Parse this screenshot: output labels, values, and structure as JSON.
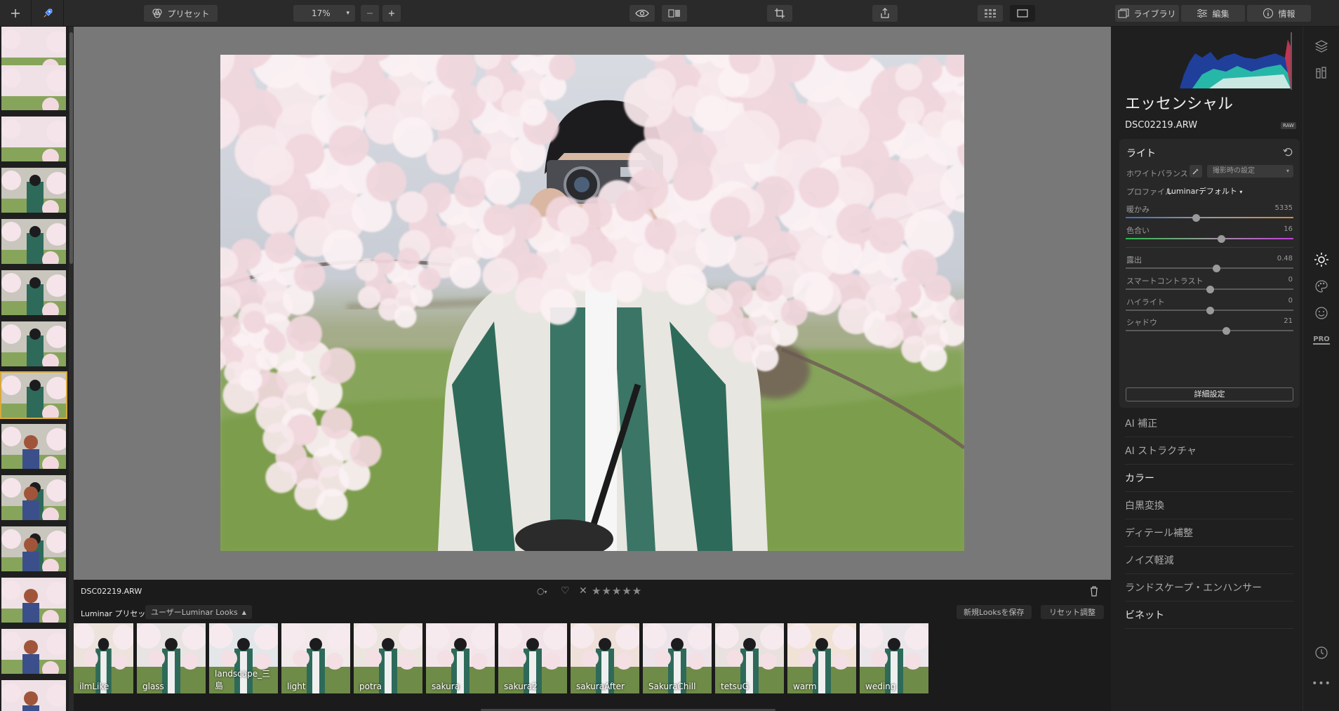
{
  "toolbar": {
    "preset_label": "プリセット",
    "zoom_value": "17%",
    "library_tab": "ライブラリ",
    "edit_tab": "編集",
    "info_tab": "情報"
  },
  "info_bar": {
    "filename": "DSC02219.ARW",
    "star_count": 5,
    "rating_stars": "★★★★★"
  },
  "preset_bar": {
    "category": "Luminar プリセット",
    "collection": "ユーザーLuminar Looks",
    "save_button": "新規Looksを保存",
    "reset_button": "リセット調整"
  },
  "presets": [
    {
      "name": "ilmLike"
    },
    {
      "name": "glass"
    },
    {
      "name": "landscape_三島"
    },
    {
      "name": "light"
    },
    {
      "name": "potra"
    },
    {
      "name": "sakura"
    },
    {
      "name": "sakura2"
    },
    {
      "name": "sakuraAfter"
    },
    {
      "name": "SakuraChill"
    },
    {
      "name": "tetsuG"
    },
    {
      "name": "warm"
    },
    {
      "name": "weding"
    }
  ],
  "panel": {
    "title": "エッセンシャル",
    "filename": "DSC02219.ARW",
    "raw_badge": "RAW",
    "light": {
      "section_title": "ライト",
      "white_balance_label": "ホワイトバランス",
      "white_balance_value": "撮影時の設定",
      "profile_label": "プロファイル",
      "profile_value": "Luminarデフォルト",
      "sliders": [
        {
          "label": "暖かみ",
          "value": "5335",
          "pos": 0.42
        },
        {
          "label": "色合い",
          "value": "16",
          "pos": 0.57
        },
        {
          "label": "露出",
          "value": "0.48",
          "pos": 0.54
        },
        {
          "label": "スマートコントラスト",
          "value": "0",
          "pos": 0.5
        },
        {
          "label": "ハイライト",
          "value": "0",
          "pos": 0.5
        },
        {
          "label": "シャドウ",
          "value": "21",
          "pos": 0.6
        }
      ],
      "advanced_button": "詳細設定"
    },
    "sections": [
      {
        "label": "AI 補正",
        "hi": false
      },
      {
        "label": "AI ストラクチャ",
        "hi": false
      },
      {
        "label": "カラー",
        "hi": true
      },
      {
        "label": "白黒変換",
        "hi": false
      },
      {
        "label": "ディテール補整",
        "hi": false
      },
      {
        "label": "ノイズ軽減",
        "hi": false
      },
      {
        "label": "ランドスケープ・エンハンサー",
        "hi": false
      },
      {
        "label": "ビネット",
        "hi": true
      }
    ]
  },
  "side_icons": {
    "pro_label": "PRO"
  },
  "colors": {
    "accent_selected": "#d9a93b",
    "warmth_gradient": [
      "#3b6ec9",
      "#d98a3a"
    ],
    "tint_gradient": [
      "#2fb84f",
      "#c23fd9"
    ]
  }
}
